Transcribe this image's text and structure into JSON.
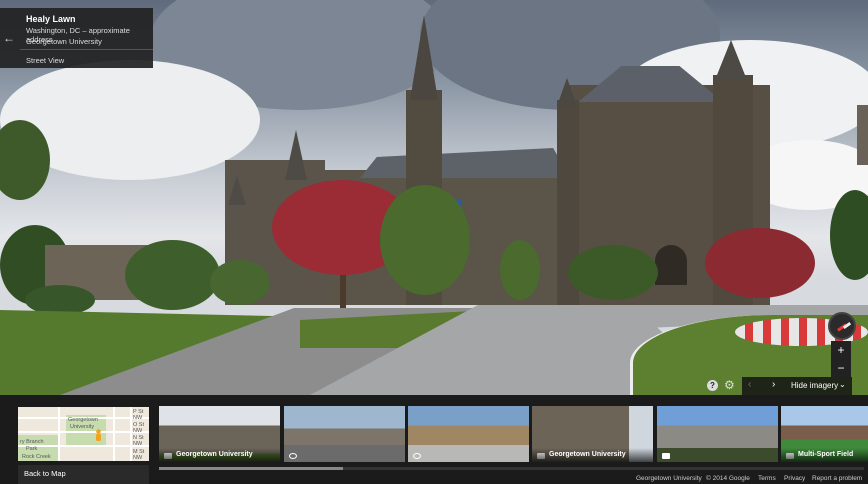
{
  "info_card": {
    "title": "Healy Lawn",
    "address": "Washington, DC – approximate address",
    "place": "Georgetown University",
    "mode": "Street View",
    "back_icon": "arrow-left-icon"
  },
  "controls": {
    "zoom_in": "+",
    "zoom_out": "−",
    "compass_icon": "compass-icon",
    "help_icon": "?",
    "gear_icon": "⚙"
  },
  "imagery": {
    "prev": "‹",
    "next": "›",
    "label": "Hide imagery",
    "chevron": "⌄"
  },
  "minimap": {
    "back_label": "Back to Map",
    "labels": [
      "Georgetown",
      "University",
      "P St NW",
      "O St NW",
      "N St NW",
      "M St NW",
      "ry Branch",
      "Park",
      "Rock Creek"
    ]
  },
  "thumbnails": [
    {
      "label": "Georgetown University",
      "icon": "camera-icon"
    },
    {
      "label": "",
      "icon": "street-view-icon"
    },
    {
      "label": "",
      "icon": "street-view-icon"
    },
    {
      "label": "Georgetown University",
      "icon": "camera-icon"
    },
    {
      "label": "",
      "icon": "camera-icon"
    },
    {
      "label": "Multi-Sport Field",
      "icon": "camera-icon"
    }
  ],
  "footer": {
    "place": "Georgetown University",
    "copyright": "© 2014 Google",
    "terms": "Terms",
    "privacy": "Privacy",
    "report": "Report a problem"
  }
}
